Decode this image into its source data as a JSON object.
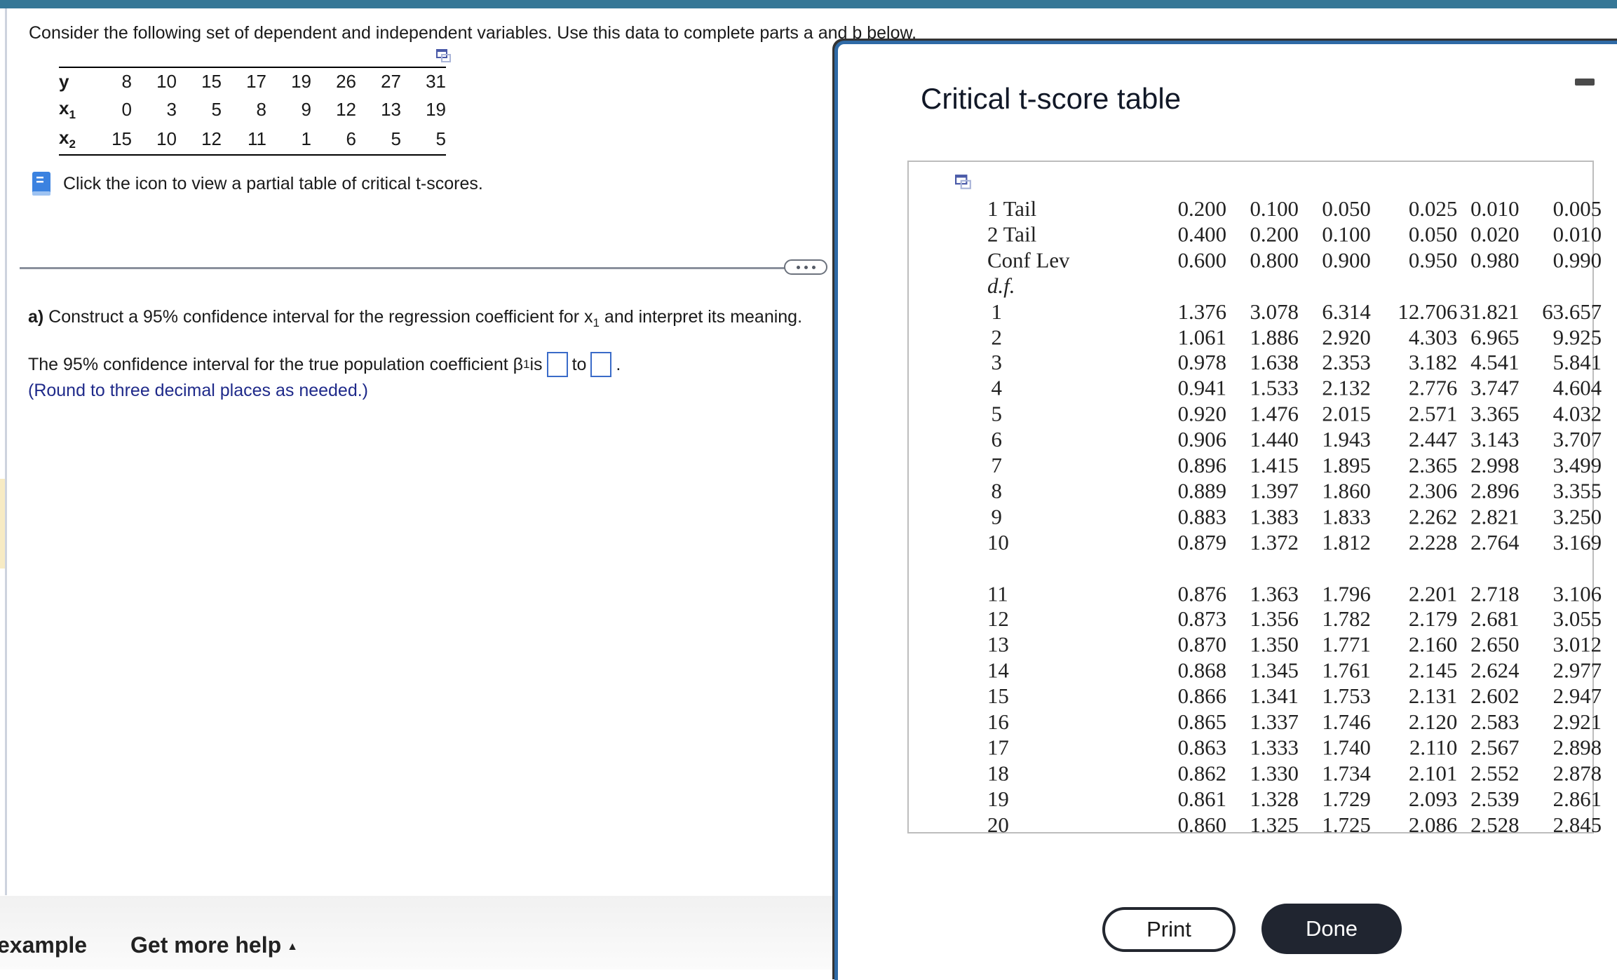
{
  "question": {
    "intro": "Consider the following set of dependent and independent variables. Use this data to complete parts a and b below.",
    "data_table": {
      "rows": [
        {
          "label": "y",
          "sub": "",
          "values": [
            "8",
            "10",
            "15",
            "17",
            "19",
            "26",
            "27",
            "31"
          ]
        },
        {
          "label": "x",
          "sub": "1",
          "values": [
            "0",
            "3",
            "5",
            "8",
            "9",
            "12",
            "13",
            "19"
          ]
        },
        {
          "label": "x",
          "sub": "2",
          "values": [
            "15",
            "10",
            "12",
            "11",
            "1",
            "6",
            "5",
            "5"
          ]
        }
      ]
    },
    "book_prompt": "Click the icon to view a partial table of critical t-scores.",
    "part_a": {
      "label": "a)",
      "text_before_sub": " Construct a 95% confidence interval for the regression coefficient for x",
      "sub": "1",
      "text_after_sub": " and interpret its meaning."
    },
    "answer_line": {
      "prefix": "The 95% confidence interval for the true population coefficient β",
      "sub": "1",
      "is": " is",
      "to": "to",
      "period": ".",
      "lower_value": "",
      "upper_value": ""
    },
    "round_note": "(Round to three decimal places as needed.)"
  },
  "footer": {
    "example_label": "example",
    "help_label": "Get more help",
    "help_arrow": "▲"
  },
  "modal": {
    "title": "Critical t-score table",
    "minimize_icon": "minimize-icon",
    "table": {
      "header_rows": [
        {
          "label": "1 Tail",
          "values": [
            "0.200",
            "0.100",
            "0.050",
            "0.025",
            "0.010",
            "0.005"
          ]
        },
        {
          "label": "2 Tail",
          "values": [
            "0.400",
            "0.200",
            "0.100",
            "0.050",
            "0.020",
            "0.010"
          ]
        },
        {
          "label": "Conf Lev",
          "values": [
            "0.600",
            "0.800",
            "0.900",
            "0.950",
            "0.980",
            "0.990"
          ]
        }
      ],
      "df_label": "d.f.",
      "rows": [
        {
          "df": "1",
          "values": [
            "1.376",
            "3.078",
            "6.314",
            "12.706",
            "31.821",
            "63.657"
          ]
        },
        {
          "df": "2",
          "values": [
            "1.061",
            "1.886",
            "2.920",
            "4.303",
            "6.965",
            "9.925"
          ]
        },
        {
          "df": "3",
          "values": [
            "0.978",
            "1.638",
            "2.353",
            "3.182",
            "4.541",
            "5.841"
          ]
        },
        {
          "df": "4",
          "values": [
            "0.941",
            "1.533",
            "2.132",
            "2.776",
            "3.747",
            "4.604"
          ]
        },
        {
          "df": "5",
          "values": [
            "0.920",
            "1.476",
            "2.015",
            "2.571",
            "3.365",
            "4.032"
          ]
        },
        {
          "df": "6",
          "values": [
            "0.906",
            "1.440",
            "1.943",
            "2.447",
            "3.143",
            "3.707"
          ]
        },
        {
          "df": "7",
          "values": [
            "0.896",
            "1.415",
            "1.895",
            "2.365",
            "2.998",
            "3.499"
          ]
        },
        {
          "df": "8",
          "values": [
            "0.889",
            "1.397",
            "1.860",
            "2.306",
            "2.896",
            "3.355"
          ]
        },
        {
          "df": "9",
          "values": [
            "0.883",
            "1.383",
            "1.833",
            "2.262",
            "2.821",
            "3.250"
          ]
        },
        {
          "df": "10",
          "values": [
            "0.879",
            "1.372",
            "1.812",
            "2.228",
            "2.764",
            "3.169"
          ]
        },
        {
          "df": "11",
          "values": [
            "0.876",
            "1.363",
            "1.796",
            "2.201",
            "2.718",
            "3.106"
          ]
        },
        {
          "df": "12",
          "values": [
            "0.873",
            "1.356",
            "1.782",
            "2.179",
            "2.681",
            "3.055"
          ]
        },
        {
          "df": "13",
          "values": [
            "0.870",
            "1.350",
            "1.771",
            "2.160",
            "2.650",
            "3.012"
          ]
        },
        {
          "df": "14",
          "values": [
            "0.868",
            "1.345",
            "1.761",
            "2.145",
            "2.624",
            "2.977"
          ]
        },
        {
          "df": "15",
          "values": [
            "0.866",
            "1.341",
            "1.753",
            "2.131",
            "2.602",
            "2.947"
          ]
        },
        {
          "df": "16",
          "values": [
            "0.865",
            "1.337",
            "1.746",
            "2.120",
            "2.583",
            "2.921"
          ]
        },
        {
          "df": "17",
          "values": [
            "0.863",
            "1.333",
            "1.740",
            "2.110",
            "2.567",
            "2.898"
          ]
        },
        {
          "df": "18",
          "values": [
            "0.862",
            "1.330",
            "1.734",
            "2.101",
            "2.552",
            "2.878"
          ]
        },
        {
          "df": "19",
          "values": [
            "0.861",
            "1.328",
            "1.729",
            "2.093",
            "2.539",
            "2.861"
          ]
        },
        {
          "df": "20",
          "values": [
            "0.860",
            "1.325",
            "1.725",
            "2.086",
            "2.528",
            "2.845"
          ]
        }
      ]
    },
    "print_label": "Print",
    "done_label": "Done"
  },
  "colors": {
    "top_bar": "#357796",
    "answer_box_border": "#3a6bc8",
    "round_note": "#1f2a8a",
    "done_button": "#202530",
    "modal_border": "#2f6aa6"
  }
}
